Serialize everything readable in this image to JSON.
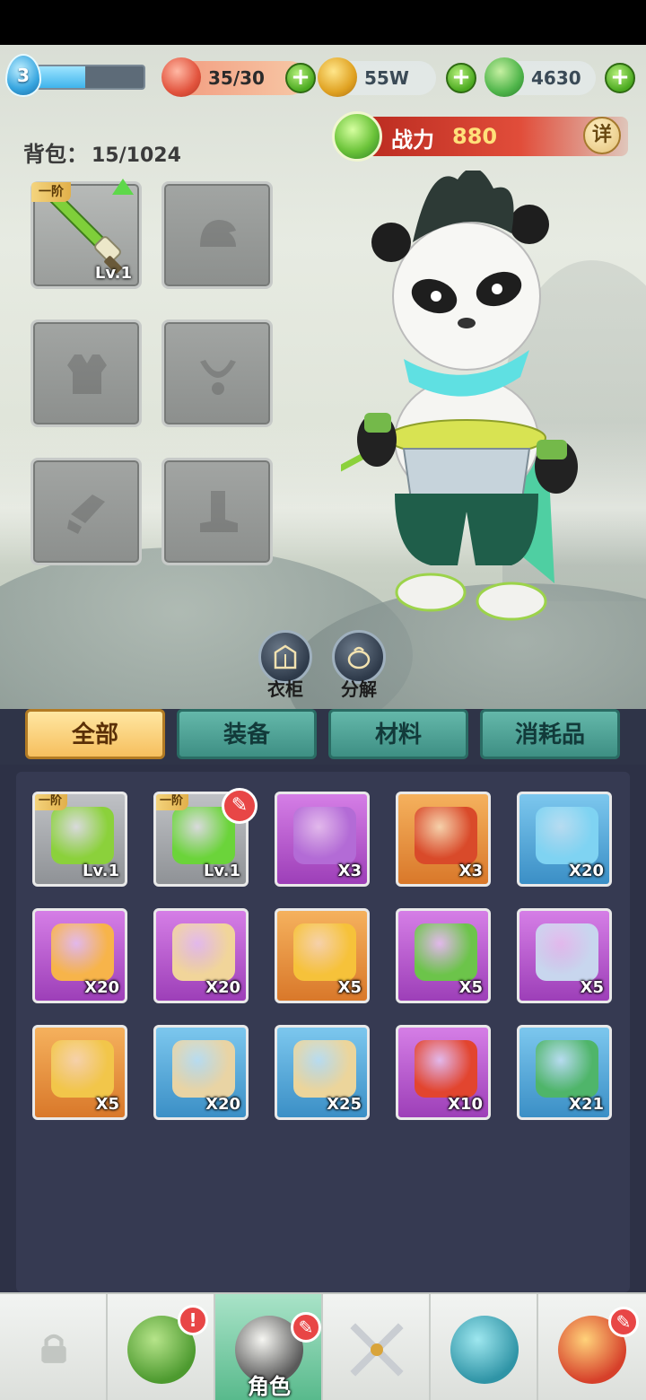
{
  "player": {
    "level": "3",
    "xp_fraction": 0.45
  },
  "resources": {
    "stamina": "35/30",
    "gold": "55W",
    "jade": "4630",
    "plus": "+"
  },
  "bag": {
    "label": "背包：",
    "count": "15/1024"
  },
  "power": {
    "label": "战力",
    "value": "880",
    "detail": "详"
  },
  "equipment": [
    {
      "tier": "一阶",
      "level": "Lv.1",
      "kind": "sword"
    },
    {
      "kind": "helmet"
    },
    {
      "kind": "armor"
    },
    {
      "kind": "necklace"
    },
    {
      "kind": "bracer"
    },
    {
      "kind": "boots"
    }
  ],
  "actions": {
    "wardrobe": "衣柜",
    "decompose": "分解"
  },
  "tabs": [
    "全部",
    "装备",
    "材料",
    "消耗品"
  ],
  "items": [
    {
      "tier": "一阶",
      "qty": "Lv.1",
      "rarity": "grey",
      "icon": "bow-icon"
    },
    {
      "tier": "一阶",
      "qty": "Lv.1",
      "rarity": "grey",
      "icon": "hat-icon",
      "badge": true
    },
    {
      "qty": "X3",
      "rarity": "purple",
      "icon": "gift-bag-icon"
    },
    {
      "qty": "X3",
      "rarity": "orange",
      "icon": "treasure-chest-icon"
    },
    {
      "qty": "X20",
      "rarity": "blue",
      "icon": "blue-lotus-icon"
    },
    {
      "qty": "X20",
      "rarity": "purple",
      "icon": "golden-lotus-icon"
    },
    {
      "qty": "X20",
      "rarity": "purple",
      "icon": "scroll-icon"
    },
    {
      "qty": "X5",
      "rarity": "orange",
      "icon": "gold-ore-icon"
    },
    {
      "qty": "X5",
      "rarity": "purple",
      "icon": "jade-pendant-icon"
    },
    {
      "qty": "X5",
      "rarity": "purple",
      "icon": "silver-key-icon"
    },
    {
      "qty": "X5",
      "rarity": "orange",
      "icon": "golden-key-icon"
    },
    {
      "qty": "X20",
      "rarity": "blue",
      "icon": "blue-scroll-icon"
    },
    {
      "qty": "X25",
      "rarity": "blue",
      "icon": "talisman-icon"
    },
    {
      "qty": "X10",
      "rarity": "purple",
      "icon": "red-talisman-icon"
    },
    {
      "qty": "X21",
      "rarity": "blue",
      "icon": "herb-bundle-icon"
    }
  ],
  "nav": [
    {
      "icon": "lock-icon"
    },
    {
      "icon": "frog-icon",
      "badge": "!"
    },
    {
      "icon": "panda-hat-icon",
      "label": "角色",
      "active": true,
      "badge": "✎"
    },
    {
      "icon": "crossed-swords-icon"
    },
    {
      "icon": "gourd-icon"
    },
    {
      "icon": "paw-crest-icon",
      "badge": "✎"
    }
  ],
  "colors": {
    "accent": "#f6bf5e",
    "panel": "#363a52",
    "tab": "#3e8f84",
    "badge": "#e84646"
  }
}
